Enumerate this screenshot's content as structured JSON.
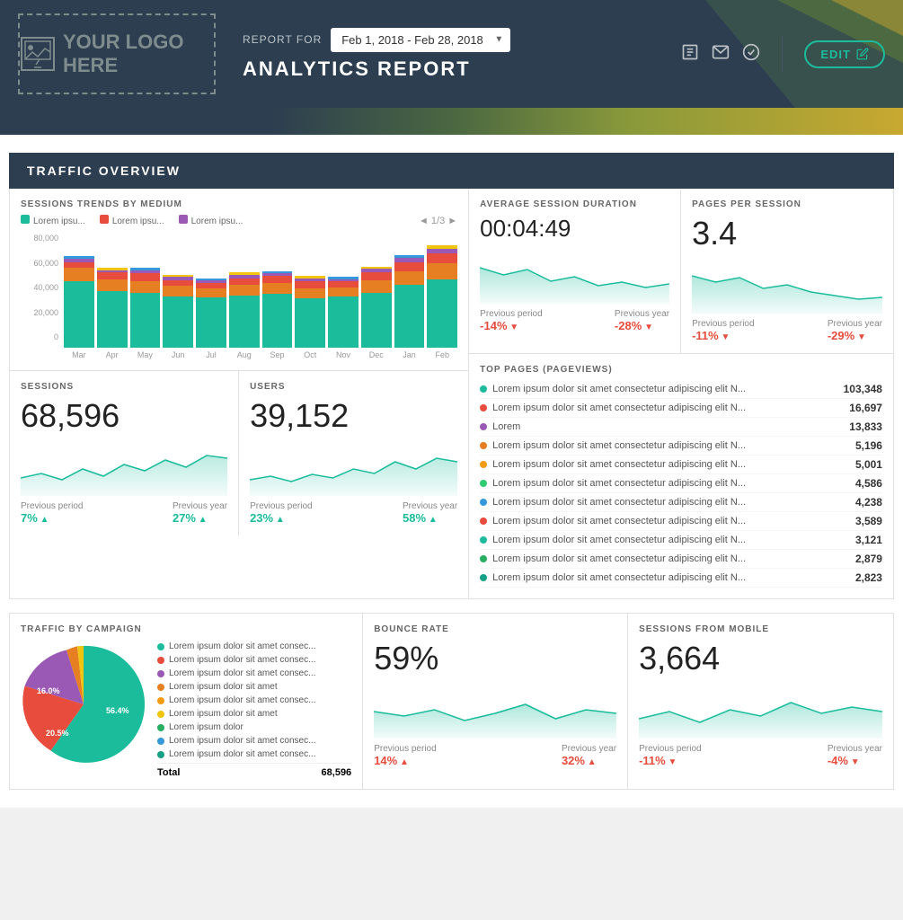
{
  "header": {
    "logo_text": "YOUR LOGO HERE",
    "report_for_label": "REPORT FOR",
    "date_range": "Feb 1, 2018 - Feb 28, 2018",
    "title": "ANALYTICS REPORT",
    "edit_label": "EDIT"
  },
  "traffic_overview": {
    "section_title": "TRAFFIC OVERVIEW",
    "sessions_trends": {
      "title": "SESSIONS TRENDS BY MEDIUM",
      "legend": [
        {
          "label": "Lorem ipsu...",
          "color": "#1abc9c"
        },
        {
          "label": "Lorem ipsu...",
          "color": "#e74c3c"
        },
        {
          "label": "Lorem ipsu...",
          "color": "#9b59b6"
        }
      ],
      "page_nav": "◄ 1/3 ►",
      "y_labels": [
        "80,000",
        "60,000",
        "40,000",
        "20,000",
        "0"
      ],
      "x_labels": [
        "Mar",
        "Apr",
        "May",
        "Jun",
        "Jul",
        "Aug",
        "Sep",
        "Oct",
        "Nov",
        "Dec",
        "Jan",
        "Feb"
      ],
      "bars": [
        {
          "segments": [
            {
              "h": 58,
              "c": "#1abc9c"
            },
            {
              "h": 12,
              "c": "#e67e22"
            },
            {
              "h": 5,
              "c": "#e74c3c"
            },
            {
              "h": 3,
              "c": "#9b59b6"
            },
            {
              "h": 2,
              "c": "#3498db"
            }
          ]
        },
        {
          "segments": [
            {
              "h": 50,
              "c": "#1abc9c"
            },
            {
              "h": 10,
              "c": "#e67e22"
            },
            {
              "h": 6,
              "c": "#e74c3c"
            },
            {
              "h": 2,
              "c": "#9b59b6"
            },
            {
              "h": 2,
              "c": "#f1c40f"
            }
          ]
        },
        {
          "segments": [
            {
              "h": 48,
              "c": "#1abc9c"
            },
            {
              "h": 10,
              "c": "#e67e22"
            },
            {
              "h": 7,
              "c": "#e74c3c"
            },
            {
              "h": 3,
              "c": "#9b59b6"
            },
            {
              "h": 2,
              "c": "#3498db"
            }
          ]
        },
        {
          "segments": [
            {
              "h": 45,
              "c": "#1abc9c"
            },
            {
              "h": 9,
              "c": "#e67e22"
            },
            {
              "h": 5,
              "c": "#e74c3c"
            },
            {
              "h": 3,
              "c": "#9b59b6"
            },
            {
              "h": 2,
              "c": "#f1c40f"
            }
          ]
        },
        {
          "segments": [
            {
              "h": 44,
              "c": "#1abc9c"
            },
            {
              "h": 8,
              "c": "#e67e22"
            },
            {
              "h": 5,
              "c": "#e74c3c"
            },
            {
              "h": 2,
              "c": "#9b59b6"
            },
            {
              "h": 2,
              "c": "#3498db"
            }
          ]
        },
        {
          "segments": [
            {
              "h": 46,
              "c": "#1abc9c"
            },
            {
              "h": 9,
              "c": "#e67e22"
            },
            {
              "h": 6,
              "c": "#e74c3c"
            },
            {
              "h": 3,
              "c": "#9b59b6"
            },
            {
              "h": 2,
              "c": "#f1c40f"
            }
          ]
        },
        {
          "segments": [
            {
              "h": 47,
              "c": "#1abc9c"
            },
            {
              "h": 10,
              "c": "#e67e22"
            },
            {
              "h": 6,
              "c": "#e74c3c"
            },
            {
              "h": 2,
              "c": "#9b59b6"
            },
            {
              "h": 2,
              "c": "#3498db"
            }
          ]
        },
        {
          "segments": [
            {
              "h": 43,
              "c": "#1abc9c"
            },
            {
              "h": 9,
              "c": "#e67e22"
            },
            {
              "h": 6,
              "c": "#e74c3c"
            },
            {
              "h": 3,
              "c": "#9b59b6"
            },
            {
              "h": 2,
              "c": "#f1c40f"
            }
          ]
        },
        {
          "segments": [
            {
              "h": 45,
              "c": "#1abc9c"
            },
            {
              "h": 8,
              "c": "#e67e22"
            },
            {
              "h": 5,
              "c": "#e74c3c"
            },
            {
              "h": 2,
              "c": "#9b59b6"
            },
            {
              "h": 2,
              "c": "#3498db"
            }
          ]
        },
        {
          "segments": [
            {
              "h": 48,
              "c": "#1abc9c"
            },
            {
              "h": 11,
              "c": "#e67e22"
            },
            {
              "h": 7,
              "c": "#e74c3c"
            },
            {
              "h": 3,
              "c": "#9b59b6"
            },
            {
              "h": 2,
              "c": "#f1c40f"
            }
          ]
        },
        {
          "segments": [
            {
              "h": 55,
              "c": "#1abc9c"
            },
            {
              "h": 12,
              "c": "#e67e22"
            },
            {
              "h": 8,
              "c": "#e74c3c"
            },
            {
              "h": 4,
              "c": "#9b59b6"
            },
            {
              "h": 2,
              "c": "#3498db"
            }
          ]
        },
        {
          "segments": [
            {
              "h": 60,
              "c": "#1abc9c"
            },
            {
              "h": 14,
              "c": "#e67e22"
            },
            {
              "h": 9,
              "c": "#e74c3c"
            },
            {
              "h": 4,
              "c": "#9b59b6"
            },
            {
              "h": 3,
              "c": "#f1c40f"
            }
          ]
        }
      ]
    },
    "avg_session": {
      "title": "AVERAGE SESSION DURATION",
      "value": "00:04:49",
      "prev_period_label": "Previous period",
      "prev_period_val": "-14%",
      "prev_period_dir": "down",
      "prev_year_label": "Previous year",
      "prev_year_val": "-28%",
      "prev_year_dir": "down"
    },
    "pages_per_session": {
      "title": "PAGES PER SESSION",
      "value": "3.4",
      "prev_period_label": "Previous period",
      "prev_period_val": "-11%",
      "prev_period_dir": "down",
      "prev_year_label": "Previous year",
      "prev_year_val": "-29%",
      "prev_year_dir": "down"
    },
    "sessions": {
      "title": "SESSIONS",
      "value": "68,596",
      "prev_period_label": "Previous period",
      "prev_period_val": "7%",
      "prev_period_dir": "up",
      "prev_year_label": "Previous year",
      "prev_year_val": "27%",
      "prev_year_dir": "up"
    },
    "users": {
      "title": "USERS",
      "value": "39,152",
      "prev_period_label": "Previous period",
      "prev_period_val": "23%",
      "prev_period_dir": "up",
      "prev_year_label": "Previous year",
      "prev_year_val": "58%",
      "prev_year_dir": "up"
    },
    "top_pages": {
      "title": "TOP PAGES (PAGEVIEWS)",
      "items": [
        {
          "color": "#1abc9c",
          "name": "Lorem ipsum dolor sit amet consectetur adipiscing elit N...",
          "value": "103,348"
        },
        {
          "color": "#e74c3c",
          "name": "Lorem ipsum dolor sit amet consectetur adipiscing elit N...",
          "value": "16,697"
        },
        {
          "color": "#9b59b6",
          "name": "Lorem",
          "value": "13,833"
        },
        {
          "color": "#e67e22",
          "name": "Lorem ipsum dolor sit amet consectetur adipiscing elit N...",
          "value": "5,196"
        },
        {
          "color": "#f39c12",
          "name": "Lorem ipsum dolor sit amet consectetur adipiscing elit N...",
          "value": "5,001"
        },
        {
          "color": "#2ecc71",
          "name": "Lorem ipsum dolor sit amet consectetur adipiscing elit N...",
          "value": "4,586"
        },
        {
          "color": "#3498db",
          "name": "Lorem ipsum dolor sit amet consectetur adipiscing elit N...",
          "value": "4,238"
        },
        {
          "color": "#e74c3c",
          "name": "Lorem ipsum dolor sit amet consectetur adipiscing elit N...",
          "value": "3,589"
        },
        {
          "color": "#1abc9c",
          "name": "Lorem ipsum dolor sit amet consectetur adipiscing elit N...",
          "value": "3,121"
        },
        {
          "color": "#27ae60",
          "name": "Lorem ipsum dolor sit amet consectetur adipiscing elit N...",
          "value": "2,879"
        },
        {
          "color": "#16a085",
          "name": "Lorem ipsum dolor sit amet consectetur adipiscing elit N...",
          "value": "2,823"
        }
      ]
    },
    "traffic_by_campaign": {
      "title": "TRAFFIC BY CAMPAIGN",
      "pie_slices": [
        {
          "color": "#1abc9c",
          "pct": 56.4,
          "label": "56.4%"
        },
        {
          "color": "#e74c3c",
          "pct": 20.5,
          "label": "20.5%"
        },
        {
          "color": "#9b59b6",
          "pct": 16.0,
          "label": "16.0%"
        },
        {
          "color": "#e67e22",
          "pct": 4.0,
          "label": ""
        },
        {
          "color": "#f1c40f",
          "pct": 3.1,
          "label": ""
        }
      ],
      "legend": [
        {
          "color": "#1abc9c",
          "text": "Lorem ipsum dolor sit amet consec..."
        },
        {
          "color": "#e74c3c",
          "text": "Lorem ipsum dolor sit amet consec..."
        },
        {
          "color": "#9b59b6",
          "text": "Lorem ipsum dolor sit amet consec..."
        },
        {
          "color": "#e67e22",
          "text": "Lorem ipsum dolor sit amet"
        },
        {
          "color": "#f39c12",
          "text": "Lorem ipsum dolor sit amet consec..."
        },
        {
          "color": "#f1c40f",
          "text": "Lorem ipsum dolor sit amet"
        },
        {
          "color": "#27ae60",
          "text": "Lorem ipsum dolor"
        },
        {
          "color": "#3498db",
          "text": "Lorem ipsum dolor sit amet consec..."
        },
        {
          "color": "#16a085",
          "text": "Lorem ipsum dolor sit amet consec..."
        }
      ],
      "total_label": "Total",
      "total_value": "68,596"
    },
    "bounce_rate": {
      "title": "BOUNCE RATE",
      "value": "59%",
      "prev_period_label": "Previous period",
      "prev_period_val": "14%",
      "prev_period_dir": "up",
      "prev_year_label": "Previous year",
      "prev_year_val": "32%",
      "prev_year_dir": "up",
      "prev_period_color": "negative",
      "prev_year_color": "negative"
    },
    "sessions_mobile": {
      "title": "SESSIONS FROM MOBILE",
      "value": "3,664",
      "prev_period_label": "Previous period",
      "prev_period_val": "-11%",
      "prev_period_dir": "down",
      "prev_year_label": "Previous year",
      "prev_year_val": "-4%",
      "prev_year_dir": "down",
      "prev_period_color": "negative",
      "prev_year_color": "negative"
    }
  }
}
